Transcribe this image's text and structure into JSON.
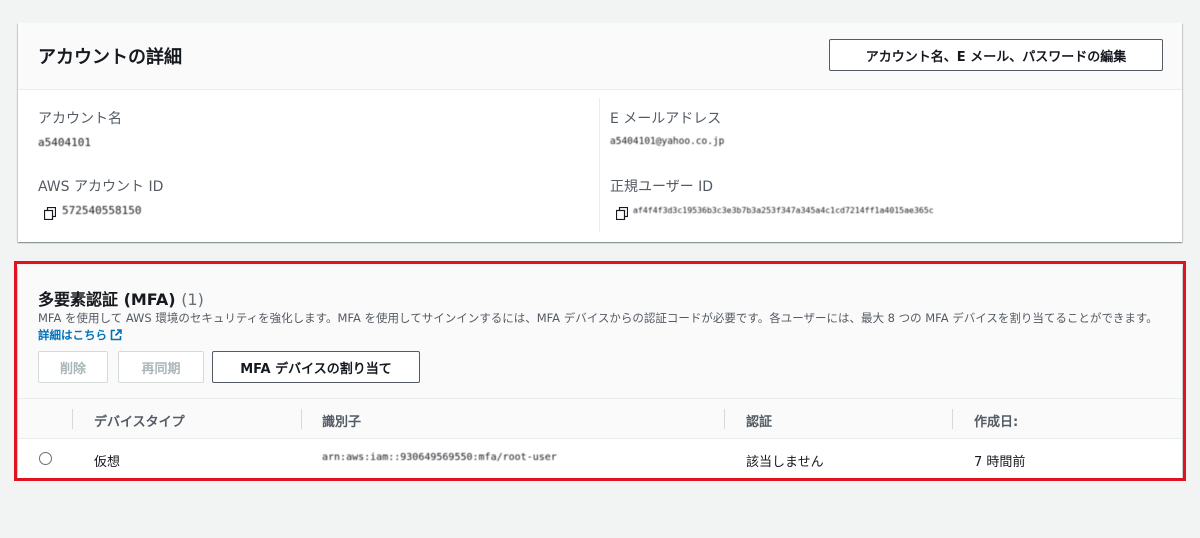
{
  "account": {
    "title": "アカウントの詳細",
    "edit_button": "アカウント名、E メール、パスワードの編集",
    "fields": {
      "account_name_label": "アカウント名",
      "account_name_value": "a5404101",
      "email_label": "E メールアドレス",
      "email_value": "a5404101@yahoo.co.jp",
      "account_id_label": "AWS アカウント ID",
      "account_id_value": "572540558150",
      "canonical_id_label": "正規ユーザー ID",
      "canonical_id_value": "af4f4f3d3c19536b3c3e3b7b3a253f347a345a4c1cd7214ff1a4015ae365c"
    }
  },
  "mfa": {
    "title": "多要素認証 (MFA)",
    "count": "(1)",
    "description": "MFA を使用して AWS 環境のセキュリティを強化します。MFA を使用してサインインするには、MFA デバイスからの認証コードが必要です。各ユーザーには、最大 8 つの MFA デバイスを割り当てることができます。",
    "learn_more": "詳細はこちら",
    "buttons": {
      "delete": "削除",
      "resync": "再同期",
      "assign": "MFA デバイスの割り当て"
    },
    "columns": [
      "デバイスタイプ",
      "識別子",
      "認証",
      "作成日:"
    ],
    "rows": [
      {
        "device_type": "仮想",
        "identifier": "arn:aws:iam::930649569550:mfa/root-user",
        "certification": "該当しません",
        "created": "7 時間前"
      }
    ]
  },
  "colors": {
    "highlight": "#e0121e",
    "link": "#0073bb",
    "page_bg": "#f2f3f3"
  },
  "icons": {
    "copy": "copy-icon",
    "external_link": "external-link-icon"
  }
}
